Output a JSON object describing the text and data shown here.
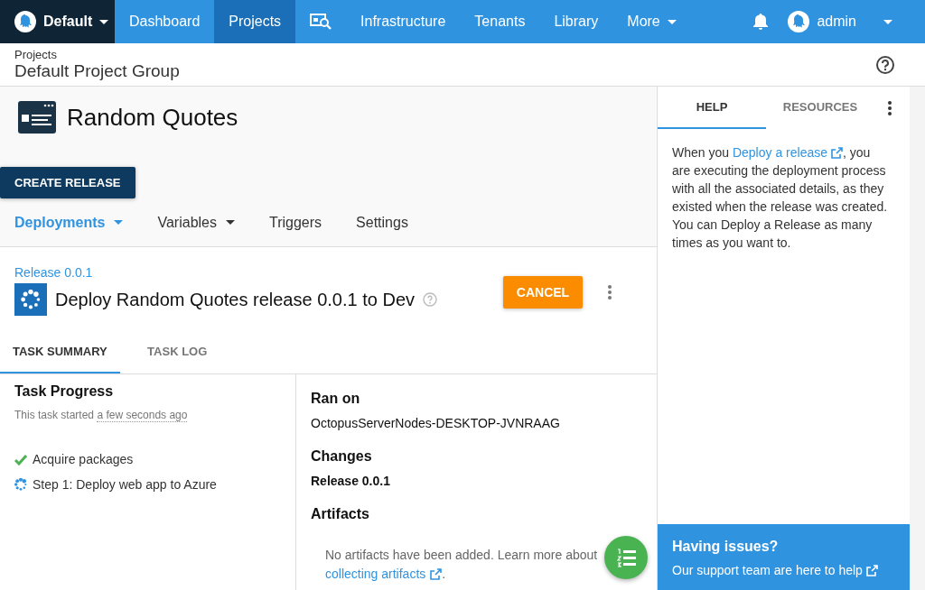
{
  "top_nav": {
    "space": "Default",
    "items": [
      {
        "kind": "link",
        "label": "Dashboard",
        "selected": false
      },
      {
        "kind": "link",
        "label": "Projects",
        "selected": true
      },
      {
        "kind": "icon",
        "selected": false
      },
      {
        "kind": "link",
        "label": "Infrastructure",
        "selected": false
      },
      {
        "kind": "link",
        "label": "Tenants",
        "selected": false
      },
      {
        "kind": "link",
        "label": "Library",
        "selected": false
      },
      {
        "kind": "menu",
        "label": "More",
        "selected": false
      }
    ],
    "user": "admin"
  },
  "breadcrumb": {
    "parent": "Projects",
    "title": "Default Project Group"
  },
  "project": {
    "name": "Random Quotes",
    "create_button": "CREATE RELEASE",
    "tabs": [
      {
        "label": "Deployments",
        "has_menu": true,
        "selected": true
      },
      {
        "label": "Variables",
        "has_menu": true,
        "selected": false
      },
      {
        "label": "Triggers",
        "has_menu": false,
        "selected": false
      },
      {
        "label": "Settings",
        "has_menu": false,
        "selected": false
      }
    ]
  },
  "task": {
    "release_link": "Release 0.0.1",
    "title": "Deploy Random Quotes release 0.0.1 to Dev",
    "cancel_button": "CANCEL",
    "tabs": [
      {
        "label": "TASK SUMMARY",
        "selected": true
      },
      {
        "label": "TASK LOG",
        "selected": false
      }
    ],
    "progress": {
      "heading": "Task Progress",
      "started_prefix": "This task started",
      "started_time": "a few seconds ago",
      "steps": [
        {
          "label": "Acquire packages",
          "done": true
        },
        {
          "label": "Step 1: Deploy web app to Azure",
          "done": false
        }
      ]
    },
    "details": {
      "ran_on_heading": "Ran on",
      "ran_on": "OctopusServerNodes-DESKTOP-JVNRAAG",
      "changes_heading": "Changes",
      "changes": "Release 0.0.1",
      "artifacts_heading": "Artifacts",
      "artifacts_text": "No artifacts have been added. Learn more about",
      "artifacts_link": "collecting artifacts",
      "artifacts_end": "."
    }
  },
  "help": {
    "tabs": [
      {
        "label": "HELP",
        "selected": true
      },
      {
        "label": "RESOURCES",
        "selected": false
      }
    ],
    "text_before": "When you ",
    "text_link": "Deploy a release",
    "text_after": ", you are executing the deployment process with all the associated details, as they existed when the release was created. You can Deploy a Release as many times as you want to.",
    "issues_heading": "Having issues?",
    "issues_link": "Our support team are here to help"
  }
}
